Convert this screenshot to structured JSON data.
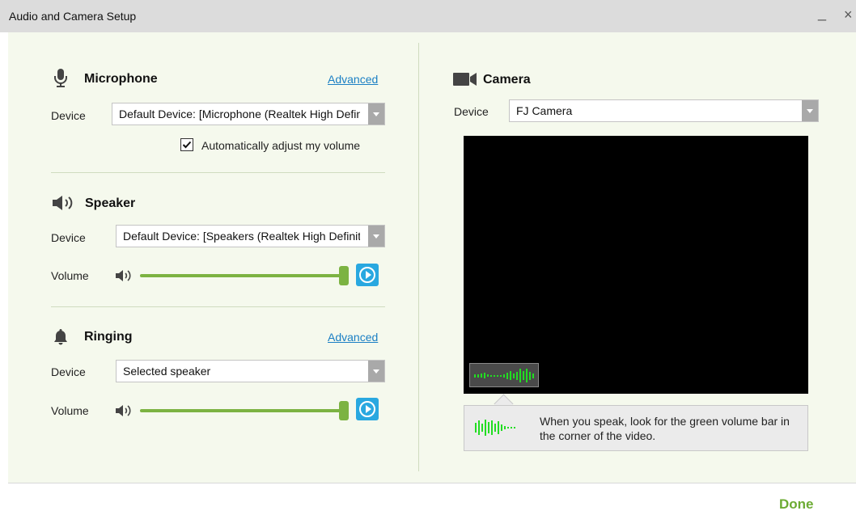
{
  "window": {
    "title": "Audio and Camera Setup",
    "minimize_glyph": "_",
    "close_glyph": "×"
  },
  "microphone": {
    "title": "Microphone",
    "icon": "microphone-icon",
    "advanced_label": "Advanced",
    "device_label": "Device",
    "device_value": "Default Device: [Microphone (Realtek High Definition Audio)]",
    "auto_adjust_label": "Automatically adjust my volume",
    "auto_adjust_checked": true
  },
  "speaker": {
    "title": "Speaker",
    "icon": "speaker-icon",
    "device_label": "Device",
    "device_value": "Default Device: [Speakers (Realtek High Definition Audio)]",
    "volume_label": "Volume",
    "volume_level": 1.0
  },
  "ringing": {
    "title": "Ringing",
    "icon": "bell-icon",
    "advanced_label": "Advanced",
    "device_label": "Device",
    "device_value": "Selected speaker",
    "volume_label": "Volume",
    "volume_level": 1.0
  },
  "camera": {
    "title": "Camera",
    "icon": "video-camera-icon",
    "device_label": "Device",
    "device_value": "FJ Camera",
    "tip_text": "When you speak, look for the green volume bar in the corner of the video."
  },
  "footer": {
    "done_label": "Done"
  },
  "colors": {
    "accent_green": "#7cb342",
    "vu_green": "#22dd22",
    "play_blue": "#29a8e0",
    "link_blue": "#1a7fc4",
    "panel_bg": "#f5f9ed",
    "titlebar_bg": "#dcdcdc"
  }
}
